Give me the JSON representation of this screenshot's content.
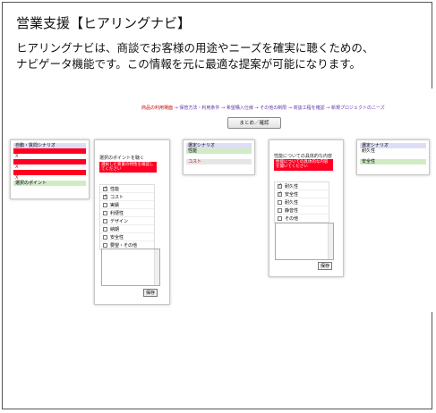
{
  "slide": {
    "title": "営業支援【ヒアリングナビ】",
    "desc_line1": "ヒアリングナビは、商談でお客様の用途やニーズを確実に聴くための、",
    "desc_line2": "ナビゲータ機能です。この情報を元に最適な提案が可能になります。"
  },
  "flow": {
    "step_active": "商品の利用場面",
    "arrow": "→",
    "steps": [
      "保管方法・利用条件",
      "希望購入仕様",
      "その他の制限",
      "商談工程を確認",
      "新規プロジェクトのニーズ"
    ]
  },
  "summary_button": "まとめ／確認",
  "panel1": {
    "header": "自動・質問シナリオ",
    "row2": "X",
    "row4": "X",
    "row6": "X",
    "footer": "選択のポイント"
  },
  "panel2": {
    "title": "選択のポイントを聴く",
    "highlight": "選択した要素の特性を確認してください",
    "checks": [
      {
        "label": "性能",
        "checked": true
      },
      {
        "label": "コスト",
        "checked": true
      },
      {
        "label": "実績",
        "checked": false
      },
      {
        "label": "利便性",
        "checked": false
      },
      {
        "label": "デザイン",
        "checked": false
      },
      {
        "label": "納期",
        "checked": false
      },
      {
        "label": "安全性",
        "checked": false
      },
      {
        "label": "要望・その他",
        "checked": false
      }
    ],
    "save": "保存"
  },
  "panel3": {
    "header": "選定シナリオ",
    "value": "性能",
    "footer": "コスト"
  },
  "panel4": {
    "title": "性能についての具体的な内容",
    "highlight": "性能についての具体的な内容を聞いてください",
    "checks": [
      {
        "label": "耐久性",
        "checked": true
      },
      {
        "label": "安全性",
        "checked": true
      },
      {
        "label": "耐久性",
        "checked": false
      },
      {
        "label": "静音性",
        "checked": false
      },
      {
        "label": "その他",
        "checked": false
      }
    ],
    "save": "保存"
  },
  "panel5": {
    "header": "選定シナリオ",
    "value": "耐久性",
    "footer": "安全性"
  }
}
